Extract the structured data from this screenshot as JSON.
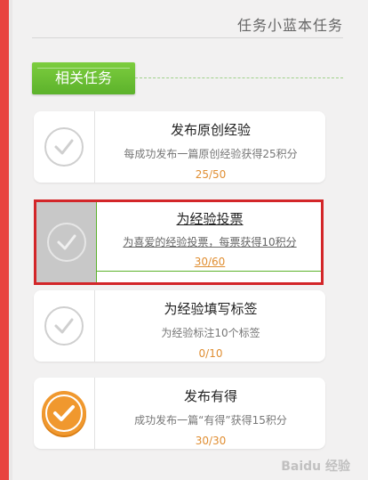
{
  "header": {
    "title": "任务小蓝本任务"
  },
  "section": {
    "tab_label": "相关任务"
  },
  "tasks": [
    {
      "title": "发布原创经验",
      "desc": "每成功发布一篇原创经验获得25积分",
      "progress": "25/50",
      "status": "incomplete"
    },
    {
      "title": "为经验投票",
      "desc": "为喜爱的经验投票，每票获得10积分",
      "progress": "30/60",
      "status": "incomplete",
      "highlighted": true
    },
    {
      "title": "为经验填写标签",
      "desc": "为经验标注10个标签",
      "progress": "0/10",
      "status": "incomplete"
    },
    {
      "title": "发布有得",
      "desc": "成功发布一篇“有得”获得15积分",
      "progress": "30/30",
      "status": "complete"
    }
  ],
  "watermark": "Baidu 经验",
  "colors": {
    "accent_green": "#5cb22b",
    "highlight_red": "#d32629",
    "progress_orange": "#e08e32",
    "complete_orange": "#f0982e"
  }
}
